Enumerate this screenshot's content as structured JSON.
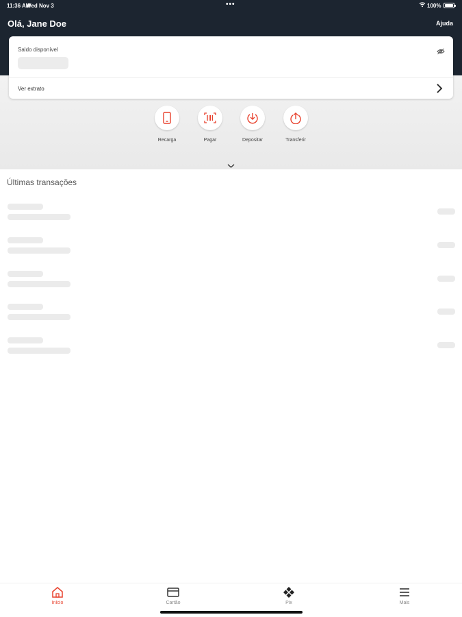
{
  "status_bar": {
    "time": "11:36 AM",
    "date": "Wed Nov 3",
    "dots": "•••",
    "battery": "100%"
  },
  "header": {
    "greeting": "Olá, Jane Doe",
    "help": "Ajuda"
  },
  "balance_card": {
    "label": "Saldo disponível",
    "statement_link": "Ver extrato"
  },
  "actions": [
    {
      "label": "Recarga",
      "icon": "phone-icon"
    },
    {
      "label": "Pagar",
      "icon": "barcode-icon"
    },
    {
      "label": "Depositar",
      "icon": "deposit-icon"
    },
    {
      "label": "Transferir",
      "icon": "transfer-icon"
    }
  ],
  "transactions": {
    "title": "Últimas transações"
  },
  "tabbar": {
    "items": [
      {
        "label": "Início",
        "icon": "home-icon",
        "active": true
      },
      {
        "label": "Cartão",
        "icon": "card-icon",
        "active": false
      },
      {
        "label": "Pix",
        "icon": "pix-icon",
        "active": false
      },
      {
        "label": "Mais",
        "icon": "menu-icon",
        "active": false
      }
    ]
  },
  "colors": {
    "header_bg": "#1c2530",
    "accent": "#e8422e",
    "skeleton": "#ebebeb"
  }
}
